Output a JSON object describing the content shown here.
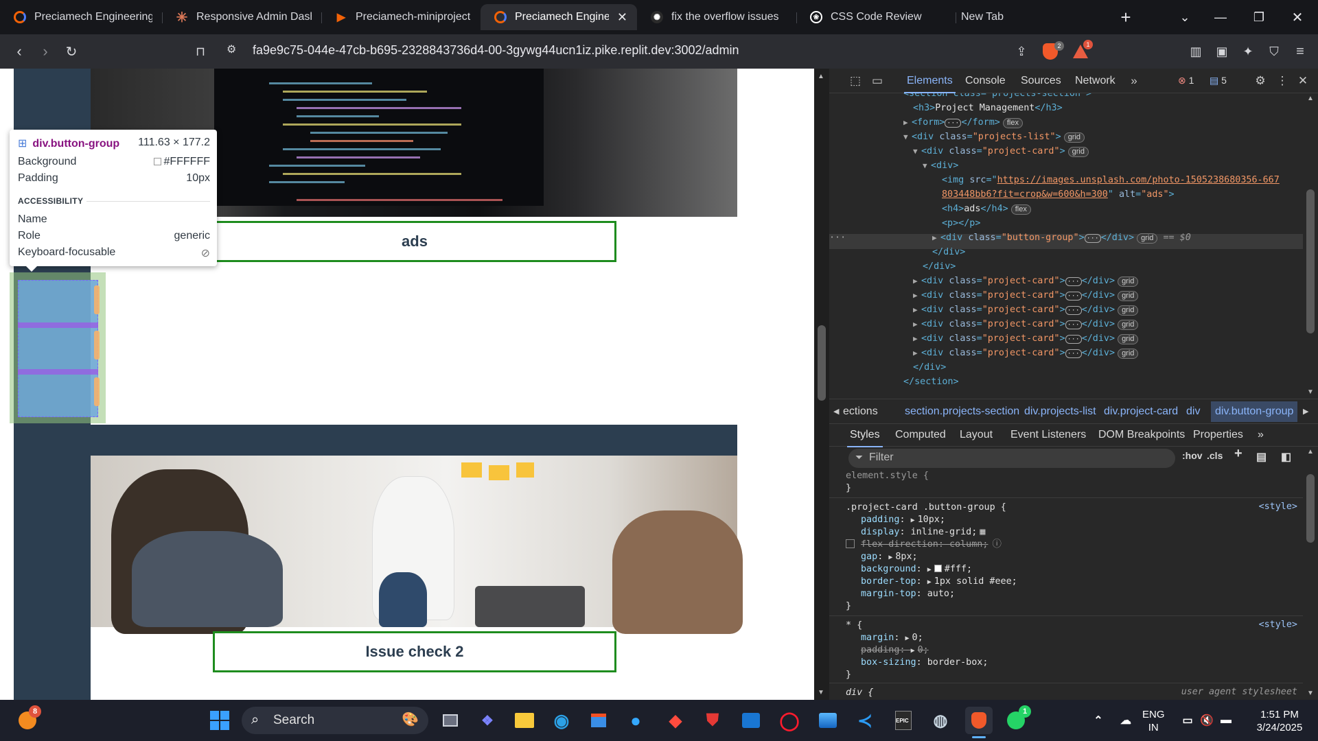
{
  "browser": {
    "tabs": [
      {
        "label": "Preciamech Engineering C",
        "icon": "replit-icon",
        "color": "#f26207"
      },
      {
        "label": "Responsive Admin Dashb",
        "icon": "claude-icon",
        "color": "#d97757"
      },
      {
        "label": "Preciamech-miniproject -",
        "icon": "replit-icon",
        "color": "#f26207"
      },
      {
        "label": "Preciamech Engineer",
        "icon": "replit-icon",
        "color": "#f26207",
        "active": true
      },
      {
        "label": "fix the overflow issues",
        "icon": "perplexity-icon",
        "color": "#ffffff"
      },
      {
        "label": "CSS Code Review",
        "icon": "chatgpt-icon",
        "color": "#ffffff"
      },
      {
        "label": "New Tab",
        "icon": "none",
        "color": "#ffffff"
      }
    ],
    "url": "fa9e9c75-044e-47cb-b695-2328843736d4-00-3gywg44ucn1iz.pike.replit.dev:3002/admin",
    "brave_badge": "2",
    "rewards_badge": "1"
  },
  "page": {
    "cards": [
      {
        "title": "ads"
      },
      {
        "title": "Issue check 2"
      }
    ],
    "tooltip": {
      "selector": "div.button-group",
      "size": "111.63 × 177.2",
      "background_label": "Background",
      "background_value": "#FFFFFF",
      "padding_label": "Padding",
      "padding_value": "10px",
      "section": "ACCESSIBILITY",
      "name_label": "Name",
      "role_label": "Role",
      "role_value": "generic",
      "focusable_label": "Keyboard-focusable"
    }
  },
  "devtools": {
    "tabs": [
      "Elements",
      "Console",
      "Sources",
      "Network"
    ],
    "error_count": "1",
    "message_count": "5",
    "dom": {
      "section_partial": "<section class=\"projects-section\">",
      "h3_text": "Project Management",
      "img_src_1": "https://images.unsplash.com/photo-1505238680356-667",
      "img_src_2": "803448bb6?fit=crop&w=600&h=300",
      "img_alt": "ads",
      "h4_text": "ads",
      "selected_marker": "== $0",
      "collapsed_cards": 6
    },
    "breadcrumbs": [
      "ections",
      "section.projects-section",
      "div.projects-list",
      "div.project-card",
      "div",
      "div.button-group"
    ],
    "style_tabs": [
      "Styles",
      "Computed",
      "Layout",
      "Event Listeners",
      "DOM Breakpoints",
      "Properties"
    ],
    "filter_placeholder": "Filter",
    "filter_tools": [
      ":hov",
      ".cls"
    ],
    "rules": {
      "element_style": "element.style {",
      "rule1_selector": ".project-card .button-group {",
      "rule1_source": "<style>",
      "rule1_props": [
        {
          "name": "padding",
          "value": "10px;"
        },
        {
          "name": "display",
          "value": "inline-grid;"
        },
        {
          "name": "flex-direction",
          "value": "column;",
          "disabled": true
        },
        {
          "name": "gap",
          "value": "8px;"
        },
        {
          "name": "background",
          "value": "#fff;"
        },
        {
          "name": "border-top",
          "value": "1px solid #eee;"
        },
        {
          "name": "margin-top",
          "value": "auto;"
        }
      ],
      "rule2_selector": "* {",
      "rule2_source": "<style>",
      "rule2_props": [
        {
          "name": "margin",
          "value": "0;"
        },
        {
          "name": "padding",
          "value": "0;",
          "overridden": true
        },
        {
          "name": "box-sizing",
          "value": "border-box;"
        }
      ],
      "rule3_selector": "div {",
      "rule3_source": "user agent stylesheet"
    }
  },
  "taskbar": {
    "search_label": "Search",
    "lang_1": "ENG",
    "lang_2": "IN",
    "time": "1:51 PM",
    "date": "3/24/2025",
    "weather_badge": "8",
    "whatsapp_badge": "1"
  }
}
